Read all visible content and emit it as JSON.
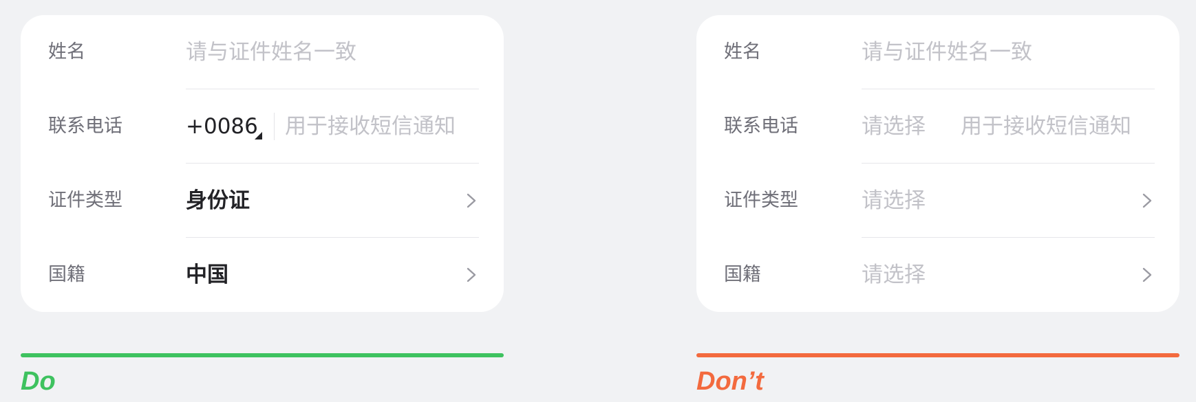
{
  "colors": {
    "do_accent": "#3ec25f",
    "dont_accent": "#f36a3e",
    "background": "#f1f2f4",
    "card": "#ffffff",
    "label": "#6f6f78",
    "placeholder": "#c2c2c8",
    "value": "#222226"
  },
  "do_panel": {
    "caption": "Do",
    "rows": [
      {
        "label": "姓名",
        "placeholder": "请与证件姓名一致"
      },
      {
        "label": "联系电话",
        "country_code": "+0086",
        "placeholder": "用于接收短信通知"
      },
      {
        "label": "证件类型",
        "value": "身份证",
        "icon": "chevron-right-icon"
      },
      {
        "label": "国籍",
        "value": "中国",
        "icon": "chevron-right-icon"
      }
    ]
  },
  "dont_panel": {
    "caption": "Don’t",
    "rows": [
      {
        "label": "姓名",
        "placeholder": "请与证件姓名一致"
      },
      {
        "label": "联系电话",
        "code_placeholder": "请选择",
        "placeholder": "用于接收短信通知"
      },
      {
        "label": "证件类型",
        "placeholder": "请选择",
        "icon": "chevron-right-icon"
      },
      {
        "label": "国籍",
        "placeholder": "请选择",
        "icon": "chevron-right-icon"
      }
    ]
  }
}
